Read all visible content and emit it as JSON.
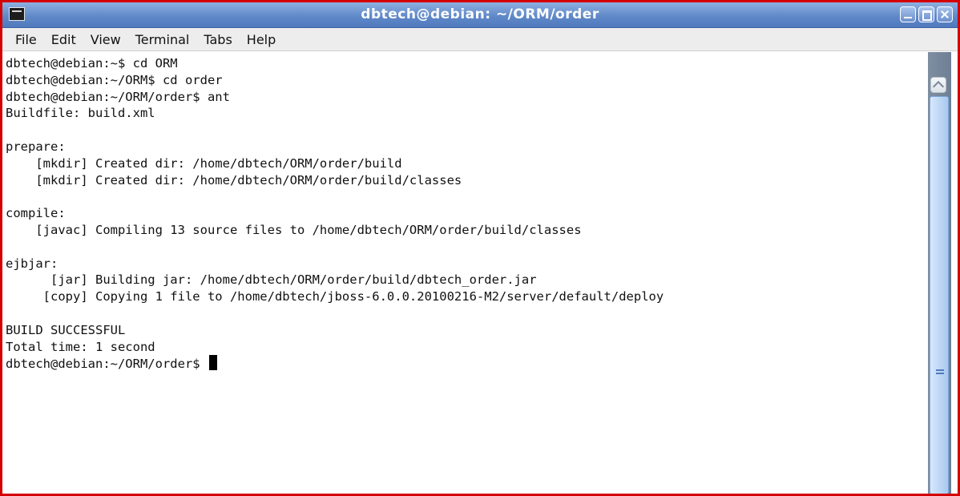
{
  "window": {
    "title": "dbtech@debian: ~/ORM/order",
    "controls": [
      {
        "name": "minimize",
        "icon": "minimize-icon"
      },
      {
        "name": "maximize",
        "icon": "maximize-icon"
      },
      {
        "name": "close",
        "icon": "close-icon"
      }
    ]
  },
  "menu": {
    "items": [
      "File",
      "Edit",
      "View",
      "Terminal",
      "Tabs",
      "Help"
    ]
  },
  "terminal": {
    "lines": [
      "dbtech@debian:~$ cd ORM",
      "dbtech@debian:~/ORM$ cd order",
      "dbtech@debian:~/ORM/order$ ant",
      "Buildfile: build.xml",
      "",
      "prepare:",
      "    [mkdir] Created dir: /home/dbtech/ORM/order/build",
      "    [mkdir] Created dir: /home/dbtech/ORM/order/build/classes",
      "",
      "compile:",
      "    [javac] Compiling 13 source files to /home/dbtech/ORM/order/build/classes",
      "",
      "ejbjar:",
      "      [jar] Building jar: /home/dbtech/ORM/order/build/dbtech_order.jar",
      "     [copy] Copying 1 file to /home/dbtech/jboss-6.0.0.20100216-M2/server/default/deploy",
      "",
      "BUILD SUCCESSFUL",
      "Total time: 1 second",
      "dbtech@debian:~/ORM/order$ "
    ]
  },
  "colors": {
    "titlebar": "#5f88c8",
    "window_border": "#d40000",
    "scrollbar": "#7f8ea0"
  }
}
